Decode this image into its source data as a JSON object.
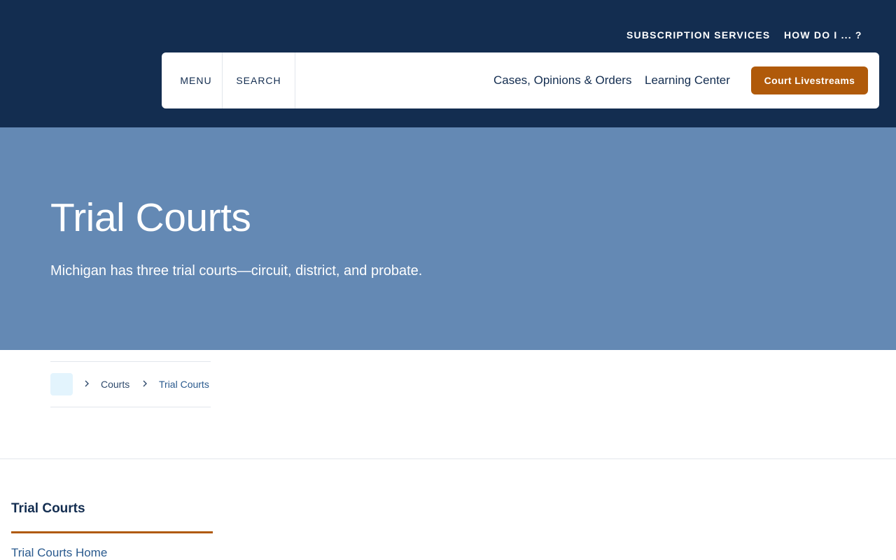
{
  "utility_nav": {
    "subscription_services": "SUBSCRIPTION SERVICES",
    "how_do_i": "HOW DO I ... ?"
  },
  "main_nav": {
    "menu": "MENU",
    "search": "SEARCH",
    "cases": "Cases, Opinions & Orders",
    "learning_center": "Learning Center",
    "livestreams_button": "Court Livestreams"
  },
  "hero": {
    "title": "Trial Courts",
    "subtitle": "Michigan has three trial courts—circuit, district, and probate."
  },
  "breadcrumb": {
    "items": [
      "Courts",
      "Trial Courts"
    ]
  },
  "sidebar": {
    "title": "Trial Courts",
    "links": [
      "Trial Courts Home"
    ]
  },
  "colors": {
    "navy": "#132d50",
    "hero_blue": "#6489b4",
    "accent_orange": "#b05a0a",
    "home_crumb_bg": "#e3f4fd"
  }
}
